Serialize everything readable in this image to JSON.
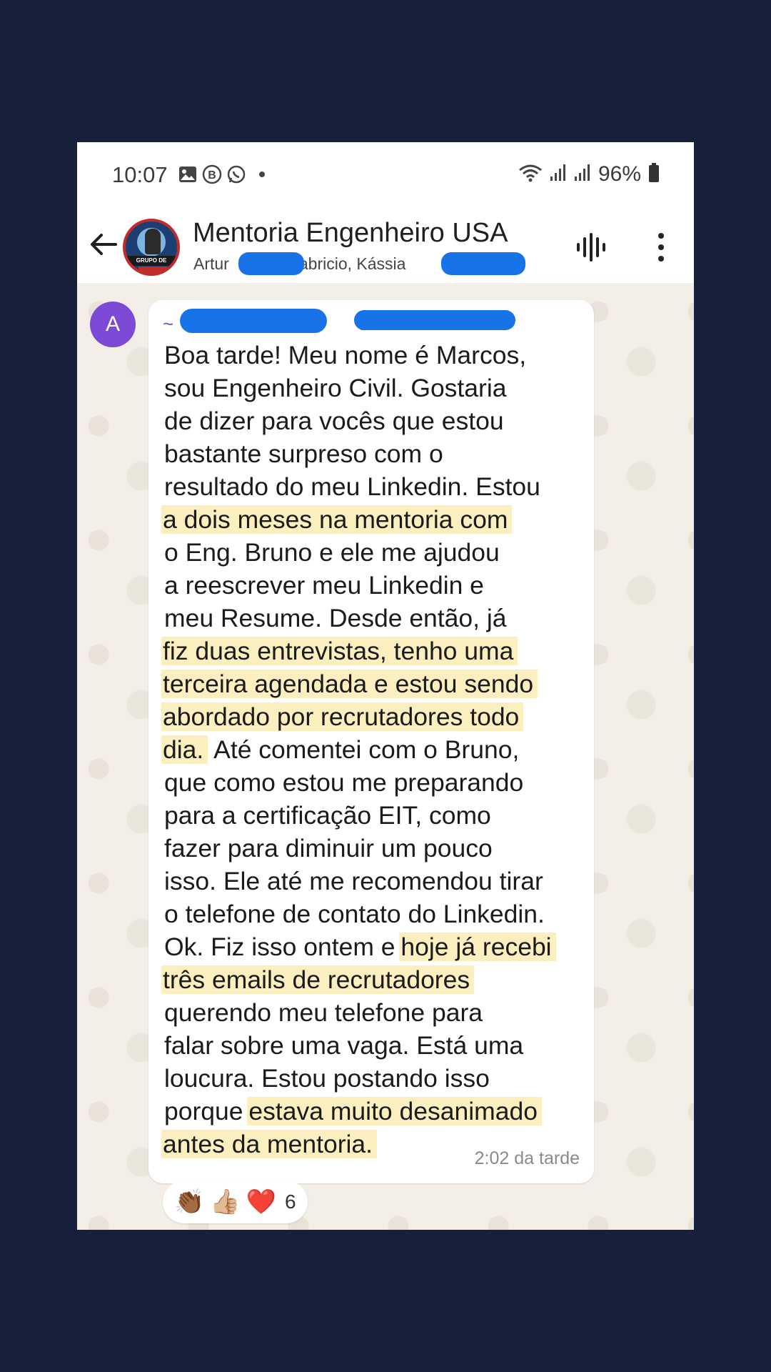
{
  "status_bar": {
    "time": "10:07",
    "battery": "96%",
    "notification_icons": [
      "gallery-icon",
      "b-badge-icon",
      "whatsapp-icon",
      "dot"
    ],
    "system_icons": [
      "wifi-icon",
      "signal-icon",
      "signal-icon",
      "battery-icon"
    ]
  },
  "header": {
    "title": "Mentoria Engenheiro USA",
    "members_part1": "Artur",
    "members_part2": "Fabricio, Kássia",
    "members_tail": ".",
    "avatar_banner": "GRUPO DE ALUNOS"
  },
  "message": {
    "sender_initial": "A",
    "sender_prefix": "~",
    "sender_suffix": "..",
    "lines": [
      {
        "segments": [
          {
            "text": "Boa tarde! Meu nome é Marcos,",
            "hl": false
          }
        ]
      },
      {
        "segments": [
          {
            "text": "sou Engenheiro Civil. Gostaria",
            "hl": false
          }
        ]
      },
      {
        "segments": [
          {
            "text": "de dizer para vocês que estou",
            "hl": false
          }
        ]
      },
      {
        "segments": [
          {
            "text": "bastante surpreso com o",
            "hl": false
          }
        ]
      },
      {
        "segments": [
          {
            "text": "resultado do meu Linkedin. Estou",
            "hl": false
          }
        ]
      },
      {
        "segments": [
          {
            "text": "a dois meses na mentoria com",
            "hl": true
          }
        ]
      },
      {
        "segments": [
          {
            "text": "o Eng. Bruno e ele me ajudou",
            "hl": false
          }
        ]
      },
      {
        "segments": [
          {
            "text": "a reescrever meu Linkedin e",
            "hl": false
          }
        ]
      },
      {
        "segments": [
          {
            "text": "meu Resume. Desde então, já",
            "hl": false
          }
        ]
      },
      {
        "segments": [
          {
            "text": "fiz duas entrevistas, tenho uma",
            "hl": true
          }
        ]
      },
      {
        "segments": [
          {
            "text": "terceira agendada e estou sendo",
            "hl": true
          }
        ]
      },
      {
        "segments": [
          {
            "text": "abordado por recrutadores todo",
            "hl": true
          }
        ]
      },
      {
        "segments": [
          {
            "text": "dia.",
            "hl": true
          },
          {
            "text": " Até comentei com o Bruno,",
            "hl": false
          }
        ]
      },
      {
        "segments": [
          {
            "text": "que como estou me preparando",
            "hl": false
          }
        ]
      },
      {
        "segments": [
          {
            "text": "para a certificação EIT, como",
            "hl": false
          }
        ]
      },
      {
        "segments": [
          {
            "text": "fazer para diminuir um pouco",
            "hl": false
          }
        ]
      },
      {
        "segments": [
          {
            "text": "isso. Ele até me recomendou tirar",
            "hl": false
          }
        ]
      },
      {
        "segments": [
          {
            "text": "o telefone de contato do Linkedin.",
            "hl": false
          }
        ]
      },
      {
        "segments": [
          {
            "text": "Ok. Fiz isso ontem e ",
            "hl": false
          },
          {
            "text": "hoje já recebi",
            "hl": true
          }
        ]
      },
      {
        "segments": [
          {
            "text": "três emails de recrutadores",
            "hl": true
          }
        ]
      },
      {
        "segments": [
          {
            "text": "querendo meu telefone para",
            "hl": false
          }
        ]
      },
      {
        "segments": [
          {
            "text": "falar sobre uma vaga. Está uma",
            "hl": false
          }
        ]
      },
      {
        "segments": [
          {
            "text": "loucura. Estou postando isso",
            "hl": false
          }
        ]
      },
      {
        "segments": [
          {
            "text": "porque ",
            "hl": false
          },
          {
            "text": "estava muito desanimado",
            "hl": true
          }
        ]
      },
      {
        "segments": [
          {
            "text": "antes da mentoria.",
            "hl": true
          }
        ]
      }
    ],
    "time": "2:02 da tarde",
    "highlight_color": "#fbeebf"
  },
  "reactions": {
    "emojis": [
      "👏🏾",
      "👍🏼",
      "❤️"
    ],
    "count": "6"
  },
  "colors": {
    "page_background": "#16203a",
    "sender_avatar": "#7b4bd6",
    "redaction": "#1872e8",
    "chat_background": "#f3efe8"
  }
}
